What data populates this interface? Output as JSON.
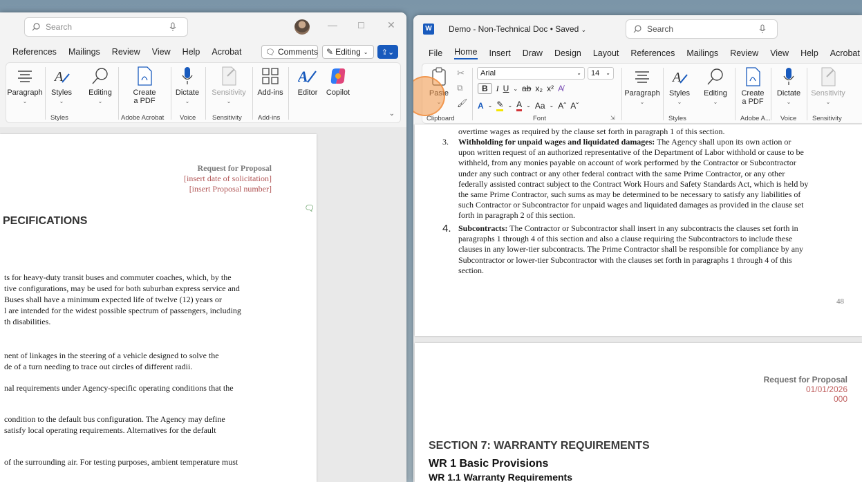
{
  "left_window": {
    "search_placeholder": "Search",
    "menu": [
      "References",
      "Mailings",
      "Review",
      "View",
      "Help",
      "Acrobat"
    ],
    "comments_label": "Comments",
    "editing_label": "Editing",
    "ribbon": {
      "paragraph": "Paragraph",
      "styles": "Styles",
      "editing": "Editing",
      "create_pdf": "Create\na PDF",
      "dictate": "Dictate",
      "sensitivity": "Sensitivity",
      "add_ins": "Add-ins",
      "editor": "Editor",
      "copilot": "Copilot",
      "groups": [
        "Styles",
        "Adobe Acrobat",
        "Voice",
        "Sensitivity",
        "Add-ins"
      ]
    },
    "doc": {
      "rfp_title": "Request for Proposal",
      "rfp_date": "[insert date of solicitation]",
      "rfp_number": "[insert Proposal number]",
      "heading": "PECIFICATIONS",
      "para1": [
        "ts for heavy-duty transit buses and commuter coaches, which, by the",
        "tive configurations, may be used for both suburban express service and",
        "Buses shall have a minimum expected life of twelve (12) years or",
        "l are intended for the widest possible spectrum of passengers, including",
        "th disabilities."
      ],
      "para2": [
        "nent of linkages in the steering of a vehicle designed to solve the",
        "de of a turn needing to trace out circles of different radii."
      ],
      "para3": "nal requirements under Agency-specific operating conditions that the",
      "para4": [
        "condition to the default bus configuration. The Agency may define",
        "satisfy local operating requirements. Alternatives for the default"
      ],
      "para5": "of the surrounding air. For testing purposes, ambient temperature must"
    }
  },
  "right_window": {
    "title": "Demo - Non-Technical Doc • Saved",
    "search_placeholder": "Search",
    "menu": [
      "File",
      "Home",
      "Insert",
      "Draw",
      "Design",
      "Layout",
      "References",
      "Mailings",
      "Review",
      "View",
      "Help",
      "Acrobat"
    ],
    "ribbon": {
      "paste": "Paste",
      "font_name": "Arial",
      "font_size": "14",
      "paragraph": "Paragraph",
      "styles": "Styles",
      "editing": "Editing",
      "create_pdf": "Create\na PDF",
      "dictate": "Dictate",
      "sensitivity": "Sensitivity",
      "groups": [
        "Clipboard",
        "Font",
        "Styles",
        "Adobe A...",
        "Voice",
        "Sensitivity"
      ]
    },
    "doc": {
      "top_line": "overtime wages as required by the clause set forth in paragraph 1 of this section.",
      "item3_num": "3.",
      "item3_title": "Withholding for unpaid wages and liquidated damages:",
      "item3_lines": [
        " The Agency shall upon its own action or",
        "upon written request of an authorized representative of the Department of Labor withhold or cause to be",
        "withheld, from any monies payable on account of work performed by the Contractor or Subcontractor",
        "under any such contract or any other federal contract with the same Prime Contractor, or any other",
        "federally assisted contract subject to the Contract Work Hours and Safety Standards Act, which is held by",
        "the same Prime Contractor, such sums as may be determined to be necessary to satisfy any liabilities of",
        "such Contractor or Subcontractor for unpaid wages and liquidated damages as provided in the clause set",
        "forth in paragraph 2 of this section."
      ],
      "item4_num": "4.",
      "item4_title": "Subcontracts:",
      "item4_lines": [
        " The Contractor or Subcontractor shall insert in any subcontracts the clauses set forth in",
        "paragraphs 1 through 4 of this section and also a clause requiring the Subcontractors to include these",
        "clauses in any lower-tier subcontracts. The Prime Contractor shall be responsible for compliance by any",
        "Subcontractor or lower-tier Subcontractor with the clauses set forth in paragraphs 1 through 4 of this",
        "section."
      ],
      "page_number": "48",
      "rfp_title": "Request for Proposal",
      "rfp_date": "01/01/2026",
      "rfp_number": "000",
      "section_heading": "SECTION 7: WARRANTY REQUIREMENTS",
      "wr1": "WR 1 Basic Provisions",
      "wr11": "WR 1.1 Warranty Requirements"
    }
  }
}
